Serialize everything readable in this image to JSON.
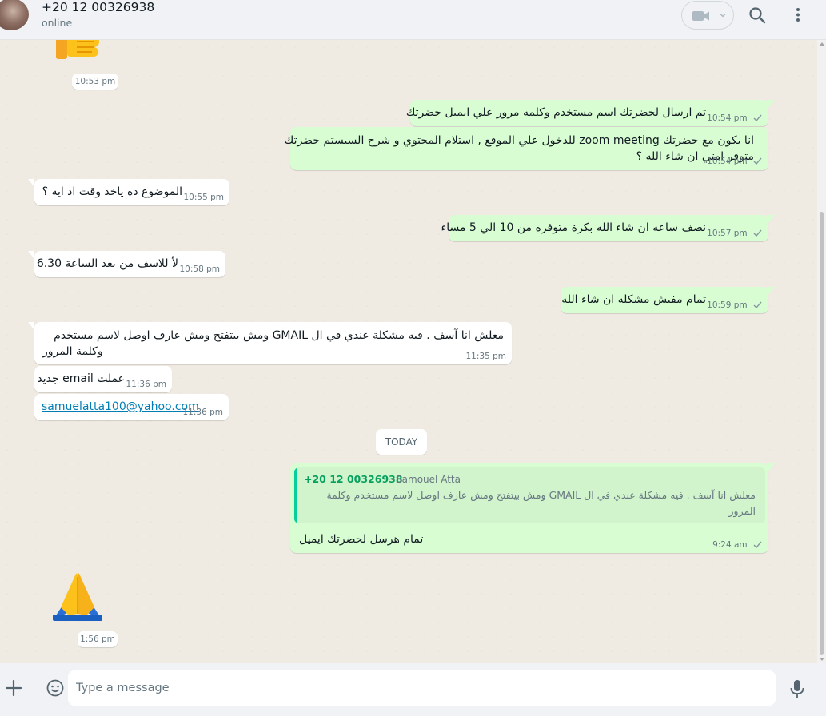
{
  "header": {
    "contact_name": "+20 12 00326938",
    "contact_status": "online",
    "icons": [
      "avatar",
      "video-call-icon",
      "chevron-down-icon",
      "search-icon",
      "menu-icon"
    ]
  },
  "messages": {
    "thumb_time": "10:53 pm",
    "m1": {
      "text": "تم ارسال لحضرتك اسم مستخدم وكلمه مرور علي ايميل حضرتك",
      "time": "10:54 pm"
    },
    "m2": {
      "line1": "انا بكون مع حضرتك zoom meeting للدخول علي الموقع , استلام المحتوي و شرح السيستم حضرتك",
      "line2": "متوفر امتي ان شاء الله ؟",
      "time": "10:54 pm"
    },
    "m3": {
      "text": "الموضوع ده ياخد وقت اد ايه ؟",
      "time": "10:55 pm"
    },
    "m4": {
      "text": "نصف ساعه ان شاء الله بكرة متوفره من 10 الي 5 مساء",
      "time": "10:57 pm"
    },
    "m5": {
      "text": "لأ للاسف من بعد الساعة 6.30",
      "time": "10:58 pm"
    },
    "m6": {
      "text": "تمام مفيش مشكله ان شاء الله",
      "time": "10:59 pm"
    },
    "m7": {
      "line1": "معلش انا آسف . فيه مشكلة عندي في ال GMAIL ومش بيتفتح ومش عارف اوصل لاسم مستخدم",
      "line2": "وكلمة المرور",
      "time": "11:35 pm"
    },
    "m8": {
      "text": "عملت email جديد",
      "time": "11:36 pm"
    },
    "m9": {
      "text": "samuelatta100@yahoo.com",
      "time": "11:36 pm"
    },
    "day_label": "TODAY",
    "m10": {
      "quote_phone": "+20 12 00326938",
      "quote_author": "~Samouel Atta",
      "quote_text": "معلش انا آسف . فيه مشكلة عندي في ال GMAIL ومش بيتفتح ومش عارف اوصل لاسم مستخدم وكلمة المرور",
      "text": "تمام هرسل لحضرتك ايميل",
      "time": "9:24 am"
    },
    "pray_time": "1:56 pm"
  },
  "footer": {
    "input_placeholder": "Type a message",
    "input_value": "",
    "icons": [
      "plus-icon",
      "emoji-icon",
      "microphone-icon"
    ]
  },
  "colors": {
    "outgoing_bubble": "#d9fdd3",
    "incoming_bubble": "#ffffff",
    "chat_background": "#efeae2",
    "header_background": "#f0f2f5",
    "quote_accent": "#06cf9c"
  }
}
